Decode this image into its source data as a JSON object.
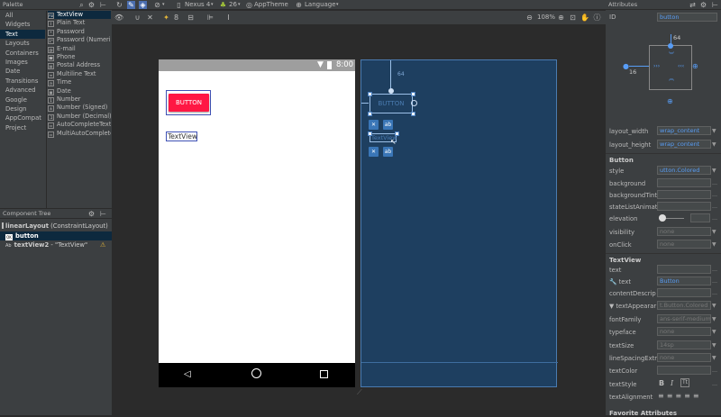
{
  "palette": {
    "title": "Palette",
    "categories": [
      "All",
      "Widgets",
      "Text",
      "Layouts",
      "Containers",
      "Images",
      "Date",
      "Transitions",
      "Advanced",
      "Google",
      "Design",
      "AppCompat",
      "Project"
    ],
    "selected_category": "Text",
    "items": [
      {
        "icon": "Ab",
        "label": "TextView"
      },
      {
        "icon": "I",
        "label": "Plain Text"
      },
      {
        "icon": "*",
        "label": "Password"
      },
      {
        "icon": "1*",
        "label": "Password (Numeric)"
      },
      {
        "icon": "@",
        "label": "E-mail"
      },
      {
        "icon": "☎",
        "label": "Phone"
      },
      {
        "icon": "▤",
        "label": "Postal Address"
      },
      {
        "icon": "≡",
        "label": "Multiline Text"
      },
      {
        "icon": "◷",
        "label": "Time"
      },
      {
        "icon": "▦",
        "label": "Date"
      },
      {
        "icon": "1",
        "label": "Number"
      },
      {
        "icon": "±",
        "label": "Number (Signed)"
      },
      {
        "icon": ".1",
        "label": "Number (Decimal)"
      },
      {
        "icon": "▭",
        "label": "AutoCompleteTextView"
      },
      {
        "icon": "▭",
        "label": "MultiAutoCompleteTextView"
      }
    ]
  },
  "toolbar": {
    "device": "Nexus 4",
    "api": "26",
    "theme": "AppTheme",
    "language": "Language",
    "zoom": "108%"
  },
  "component_tree": {
    "title": "Component Tree",
    "root_name": "linearLayout",
    "root_type": "(ConstraintLayout)",
    "children": [
      {
        "icon": "OK",
        "name": "button",
        "detail": ""
      },
      {
        "icon": "Ab",
        "name": "textView2",
        "detail": "- \"TextView\""
      }
    ]
  },
  "design": {
    "status_time": "8:00",
    "button_label": "BUTTON",
    "textview_label": "TextView",
    "blueprint_button_label": "BUTTON",
    "blueprint_textview_label": "TextView",
    "margin_label": "64"
  },
  "attributes": {
    "title": "Attributes",
    "id_label": "ID",
    "id_value": "button",
    "inspector_margin_top": "64",
    "inspector_margin_left": "16",
    "layout_width_label": "layout_width",
    "layout_width_value": "wrap_content",
    "layout_height_label": "layout_height",
    "layout_height_value": "wrap_content",
    "button_section": "Button",
    "style_label": "style",
    "style_value": "utton.Colored",
    "rows1": [
      {
        "label": "background",
        "value": ""
      },
      {
        "label": "backgroundTint",
        "value": ""
      },
      {
        "label": "stateListAnimat",
        "value": ""
      }
    ],
    "elevation_label": "elevation",
    "visibility_label": "visibility",
    "visibility_value": "none",
    "onclick_label": "onClick",
    "onclick_value": "none",
    "textview_section": "TextView",
    "text_label": "text",
    "text_value": "",
    "text_tools_label": "text",
    "text_tools_value": "Button",
    "content_desc_label": "contentDescrip",
    "text_appearance_label": "▼ textAppearar",
    "text_appearance_value": "t.Button.Colored",
    "font_family_label": "fontFamily",
    "font_family_value": "ans-serif-medium",
    "typeface_label": "typeface",
    "typeface_value": "none",
    "text_size_label": "textSize",
    "text_size_value": "14sp",
    "line_spacing_label": "lineSpacingExtr",
    "line_spacing_value": "none",
    "text_color_label": "textColor",
    "text_style_label": "textStyle",
    "text_alignment_label": "textAlignment",
    "favorite_section": "Favorite Attributes"
  }
}
